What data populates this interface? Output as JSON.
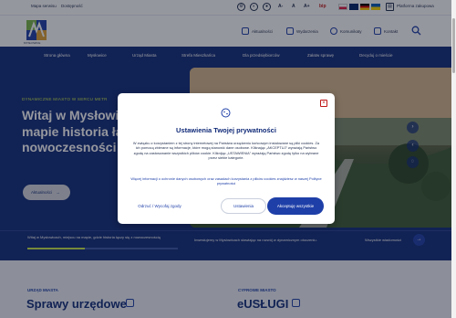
{
  "topbar": {
    "sitemap": "Mapa serwisu",
    "accessibility": "Dostępność",
    "font_a_minus": "A-",
    "font_a": "A",
    "font_a_plus": "A+",
    "bip": "bip",
    "platform": "Platforma zakupowa"
  },
  "header": {
    "logo_text": "MYSŁOWICE",
    "links": {
      "news": "Aktualności",
      "events": "Wydarzenia",
      "contacts": "Komunikaty",
      "contact": "Kontakt"
    }
  },
  "nav": {
    "items": [
      "Strona główna",
      "Mysłowice",
      "Urząd Miasta",
      "Strefa Mieszkańca",
      "Dla przedsiębiorców",
      "Załatw sprawę",
      "Decyduj o mieście"
    ]
  },
  "hero": {
    "tag": "DYNAMICZNE MIASTO W SERCU METR",
    "title": "Witaj w Mysłowic miejscu na mapie historia łączy się z nowoczesności",
    "button": "Aktualności",
    "arrow": "→",
    "next": "›",
    "prev": "‹"
  },
  "strip": {
    "slide1": "Witaj w Mysłowicach, miejscu na mapie, gdzie historia łączy się z nowoczesnością",
    "slide2": "Inwestujemy w Mysłowicach stawiając na rozwój w dynamicznym otoczeniu.",
    "slide3": "Wszystkie wiadomości",
    "arrow": "→",
    "progress": 0.38
  },
  "lower": {
    "left_tag": "URZĄD MIASTA",
    "left_title": "Sprawy urzędowe",
    "right_tag": "CYFROWE MIASTO",
    "right_title": "eUSŁUGI"
  },
  "modal": {
    "title": "Ustawienia Twojej prywatności",
    "body": "W związku z korzystaniem z tej strony internetowej na Państwa urządzeniu końcowym instalowane są pliki cookies. Za ich pomocą zbierane są informacje, które mogą stanowić dane osobowe. Kliknając „AKCEPTUJ” wyrażają Państwo zgodę na zastosowanie wszystkich plików cookie. Kliknijąc „USTAWIENIA” wyrażają Państwo zgodę tylko na wybrane przez siebie kategorie.",
    "link": "Więcej informacji o ochronie danych osobowych oraz zasadach korzystania z plików cookies znajdziesz w naszej Polityce prywatności",
    "reject": "Odrzuć / Wycofaj zgody",
    "settings": "Ustawienia",
    "accept": "Akceptuję wszystkie",
    "close": "×"
  },
  "colors": {
    "navy": "#102a78",
    "accent": "#1e3fa8",
    "lime": "#c8e84a",
    "close_red": "#c01818"
  }
}
